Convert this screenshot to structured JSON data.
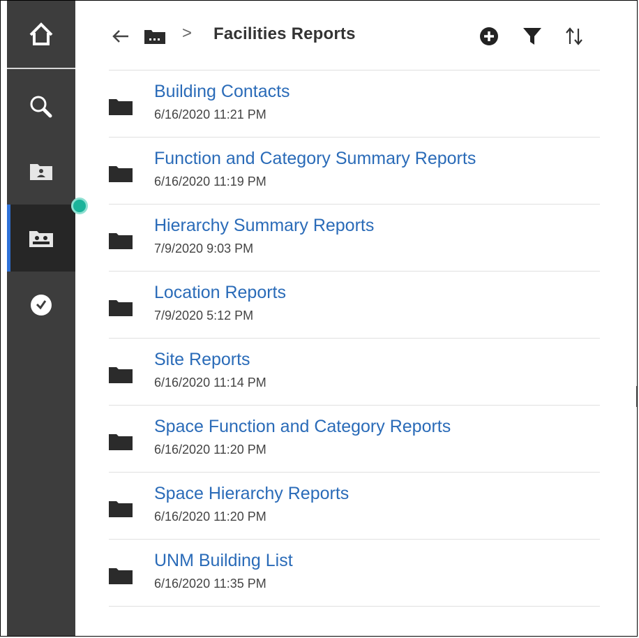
{
  "header": {
    "title": "Facilities Reports",
    "crumb_separator": ">"
  },
  "icons": {
    "back": "arrow-left-icon",
    "breadcrumb": "team-folder-icon",
    "add": "add-circle-icon",
    "filter": "filter-icon",
    "sort": "sort-icon",
    "rail": [
      "home-icon",
      "search-icon",
      "my-content-icon",
      "team-content-icon",
      "recent-icon"
    ]
  },
  "colors": {
    "rail_bg": "#3d3d3d",
    "rail_active_bg": "#262626",
    "rail_active_indicator": "#2f72d8",
    "link": "#2a6bb8",
    "notification": "#1bb39a"
  },
  "items": [
    {
      "name": "Building Contacts",
      "date": "6/16/2020 11:21 PM"
    },
    {
      "name": "Function and Category Summary Reports",
      "date": "6/16/2020 11:19 PM"
    },
    {
      "name": "Hierarchy Summary Reports",
      "date": "7/9/2020 9:03 PM"
    },
    {
      "name": "Location Reports",
      "date": "7/9/2020 5:12 PM"
    },
    {
      "name": "Site Reports",
      "date": "6/16/2020 11:14 PM"
    },
    {
      "name": "Space Function and Category Reports",
      "date": "6/16/2020 11:20 PM"
    },
    {
      "name": "Space Hierarchy Reports",
      "date": "6/16/2020 11:20 PM"
    },
    {
      "name": "UNM Building List",
      "date": "6/16/2020 11:35 PM"
    }
  ]
}
